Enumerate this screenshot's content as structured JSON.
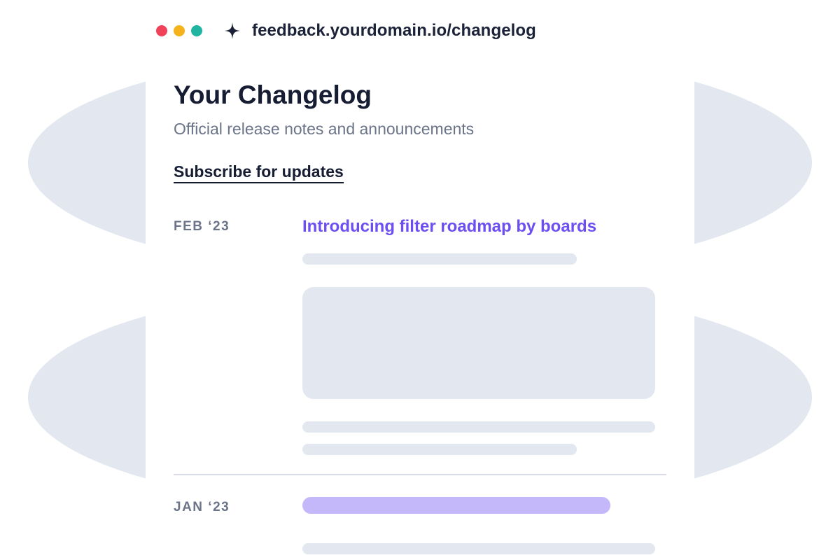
{
  "browser": {
    "url": "feedback.yourdomain.io/changelog",
    "traffic_lights": [
      "#f0435a",
      "#f6b21b",
      "#1fb5a0"
    ],
    "icon": "sparkle-icon"
  },
  "page": {
    "title": "Your Changelog",
    "subtitle": "Official release notes and announcements",
    "subscribe_label": "Subscribe for updates"
  },
  "entries": [
    {
      "date": "FEB ‘23",
      "title": "Introducing filter roadmap by boards"
    },
    {
      "date": "JAN ‘23",
      "title": ""
    }
  ],
  "colors": {
    "accent": "#6c4ef2",
    "accent_light": "#c4b8fa",
    "skeleton": "#e2e7f0",
    "heading": "#161d33",
    "muted": "#6b7489"
  }
}
